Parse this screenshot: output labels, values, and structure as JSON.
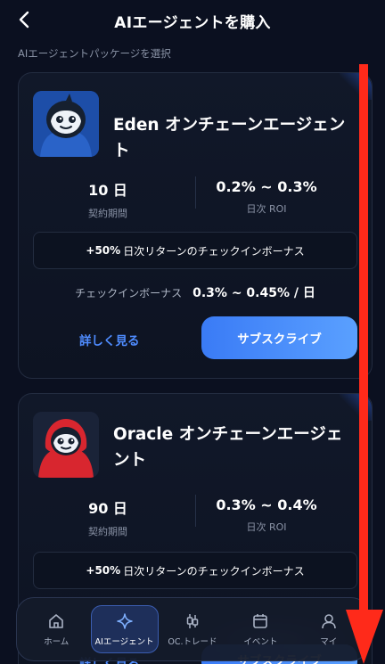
{
  "header": {
    "title": "AIエージェントを購入",
    "back_icon": "chevron-left-icon"
  },
  "section_label": "AIエージェントパッケージを選択",
  "agents": [
    {
      "name": "Eden オンチェーンエージェント",
      "contract_value": "10 日",
      "contract_label": "契約期間",
      "roi_value": "0.2% ~ 0.3%",
      "roi_label": "日次 ROI",
      "bonus_pct": "+50%",
      "bonus_text": "日次リターンのチェックインボーナス",
      "checkin_label": "チェックインボーナス",
      "checkin_value": "0.3% ~ 0.45% / 日",
      "detail_label": "詳しく見る",
      "subscribe_label": "サブスクライブ",
      "avatar_color": "#1d4ea8"
    },
    {
      "name": "Oracle オンチェーンエージェント",
      "contract_value": "90 日",
      "contract_label": "契約期間",
      "roi_value": "0.3% ~ 0.4%",
      "roi_label": "日次 ROI",
      "bonus_pct": "+50%",
      "bonus_text": "日次リターンのチェックインボーナス",
      "detail_label": "詳しく見る",
      "subscribe_label": "サブスクライブ",
      "avatar_color": "#d8262f"
    }
  ],
  "nav": {
    "items": [
      {
        "label": "ホーム",
        "icon": "home-icon"
      },
      {
        "label": "AIエージェント",
        "icon": "sparkle-icon",
        "active": true
      },
      {
        "label": "OC.トレード",
        "icon": "candlestick-icon"
      },
      {
        "label": "イベント",
        "icon": "calendar-icon"
      },
      {
        "label": "マイ",
        "icon": "user-icon"
      }
    ]
  },
  "colors": {
    "background": "#0b1020",
    "accent": "#4f8cff",
    "overlay_arrow": "#ff2a1a"
  }
}
